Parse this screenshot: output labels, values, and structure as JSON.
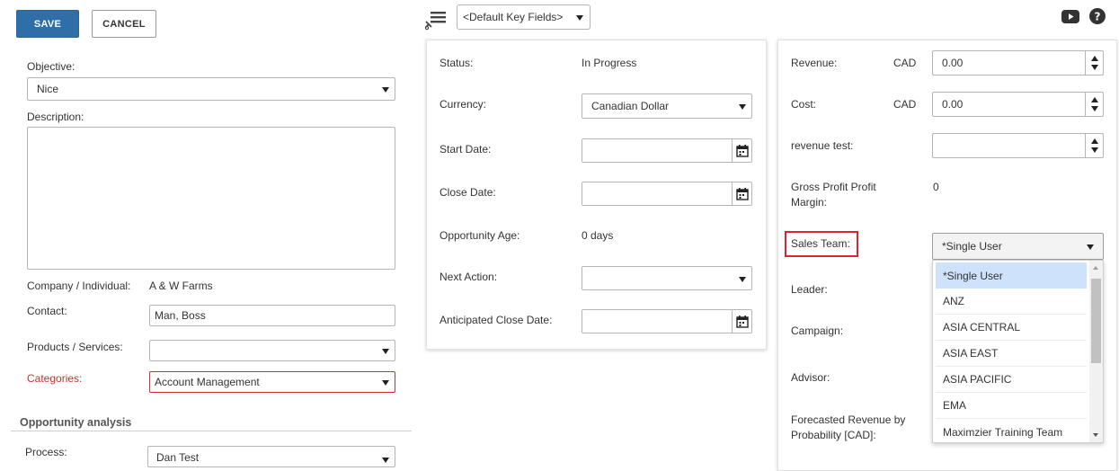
{
  "toolbar": {
    "save_label": "SAVE",
    "cancel_label": "CANCEL"
  },
  "header": {
    "key_fields_value": "<Default Key Fields>",
    "icons": [
      "menu-filter-icon",
      "youtube-icon",
      "help-icon"
    ]
  },
  "left": {
    "objective_label": "Objective:",
    "objective_value": "Nice",
    "description_label": "Description:",
    "company_label": "Company / Individual:",
    "company_value": "A & W Farms",
    "contact_label": "Contact:",
    "contact_value": "Man, Boss",
    "products_label": "Products / Services:",
    "products_value": "",
    "categories_label": "Categories:",
    "categories_value": "Account Management",
    "section_title": "Opportunity analysis",
    "process_label": "Process:",
    "process_value": "Dan Test"
  },
  "middle": {
    "status_label": "Status:",
    "status_value": "In Progress",
    "currency_label": "Currency:",
    "currency_value": "Canadian Dollar",
    "start_date_label": "Start Date:",
    "close_date_label": "Close Date:",
    "age_label": "Opportunity Age:",
    "age_value": "0 days",
    "next_action_label": "Next Action:",
    "anticipated_label": "Anticipated Close Date:"
  },
  "right": {
    "revenue_label": "Revenue:",
    "revenue_currency": "CAD",
    "revenue_value": "0.00",
    "cost_label": "Cost:",
    "cost_currency": "CAD",
    "cost_value": "0.00",
    "revenue_test_label": "revenue test:",
    "gross_profit_label_1": "Gross Profit Profit",
    "gross_profit_label_2": "Margin:",
    "gross_profit_value": "0",
    "sales_team_label": "Sales Team:",
    "sales_team_value": "*Single User",
    "leader_label": "Leader:",
    "campaign_label": "Campaign:",
    "advisor_label": "Advisor:",
    "forecast_label_1": "Forecasted Revenue by",
    "forecast_label_2": "Probability [CAD]:"
  },
  "sales_team_options": [
    "*Single User",
    "ANZ",
    "ASIA CENTRAL",
    "ASIA EAST",
    "ASIA PACIFIC",
    "EMA",
    "Maximzier Training Team"
  ],
  "colors": {
    "primary": "#2f6ea6",
    "required": "#d0302f",
    "highlight": "#e0232e",
    "selected_option": "#cfe2fb"
  }
}
